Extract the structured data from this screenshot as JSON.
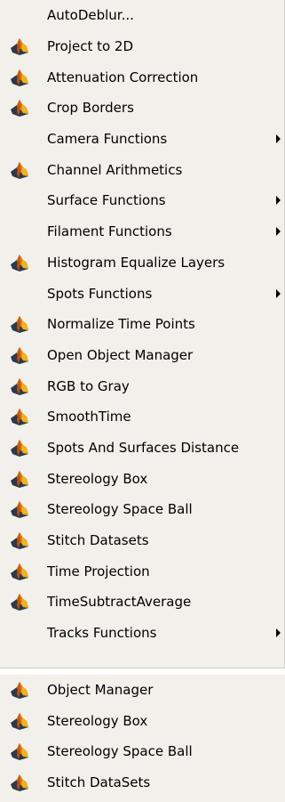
{
  "menu": {
    "items": [
      {
        "label": "AutoDeblur...",
        "icon": false,
        "submenu": false
      },
      {
        "label": "Project to 2D",
        "icon": true,
        "submenu": false
      },
      {
        "label": "Attenuation Correction",
        "icon": true,
        "submenu": false
      },
      {
        "label": "Crop Borders",
        "icon": true,
        "submenu": false
      },
      {
        "label": "Camera Functions",
        "icon": false,
        "submenu": true
      },
      {
        "label": "Channel Arithmetics",
        "icon": true,
        "submenu": false
      },
      {
        "label": "Surface Functions",
        "icon": false,
        "submenu": true
      },
      {
        "label": "Filament Functions",
        "icon": false,
        "submenu": true
      },
      {
        "label": "Histogram Equalize Layers",
        "icon": true,
        "submenu": false
      },
      {
        "label": "Spots Functions",
        "icon": false,
        "submenu": true
      },
      {
        "label": "Normalize Time Points",
        "icon": true,
        "submenu": false
      },
      {
        "label": "Open Object Manager",
        "icon": true,
        "submenu": false
      },
      {
        "label": "RGB to Gray",
        "icon": true,
        "submenu": false
      },
      {
        "label": "SmoothTime",
        "icon": true,
        "submenu": false
      },
      {
        "label": "Spots And Surfaces Distance",
        "icon": true,
        "submenu": false
      },
      {
        "label": "Stereology Box",
        "icon": true,
        "submenu": false
      },
      {
        "label": "Stereology Space Ball",
        "icon": true,
        "submenu": false
      },
      {
        "label": "Stitch Datasets",
        "icon": true,
        "submenu": false
      },
      {
        "label": "Time Projection",
        "icon": true,
        "submenu": false
      },
      {
        "label": "TimeSubtractAverage",
        "icon": true,
        "submenu": false
      },
      {
        "label": "Tracks Functions",
        "icon": false,
        "submenu": true
      }
    ]
  },
  "menu2": {
    "items": [
      {
        "label": "Object Manager",
        "icon": true
      },
      {
        "label": "Stereology Box",
        "icon": true
      },
      {
        "label": "Stereology Space Ball",
        "icon": true
      },
      {
        "label": "Stitch DataSets",
        "icon": true
      }
    ]
  },
  "icon_name": "matlab-membrane-icon",
  "colors": {
    "icon_orange": "#e07a10",
    "icon_dark": "#2b3a4a",
    "icon_yellow": "#f2b21e"
  }
}
